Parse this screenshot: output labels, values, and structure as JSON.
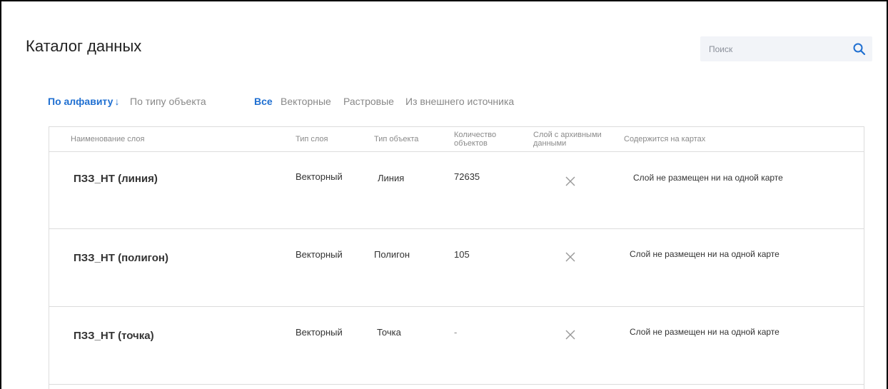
{
  "page": {
    "title": "Каталог данных"
  },
  "search": {
    "placeholder": "Поиск"
  },
  "sort": [
    {
      "label": "По алфавиту",
      "active": true,
      "arrow": "↓"
    },
    {
      "label": "По типу объекта",
      "active": false
    }
  ],
  "filters": [
    {
      "label": "Все",
      "active": true
    },
    {
      "label": "Векторные",
      "active": false
    },
    {
      "label": "Растровые",
      "active": false
    },
    {
      "label": "Из внешнего источника",
      "active": false
    }
  ],
  "table": {
    "headers": {
      "name": "Наименование слоя",
      "layer_type": "Тип слоя",
      "object_type": "Тип объекта",
      "count": "Количество объектов",
      "archive": "Слой с архивными данными",
      "maps": "Содержится на картах"
    },
    "rows": [
      {
        "name": "ПЗЗ_НТ (линия)",
        "layer_type": "Векторный",
        "object_type": "Линия",
        "count": "72635",
        "archive_icon": "close-icon",
        "maps": "Слой не размещен ни на одной карте"
      },
      {
        "name": "ПЗЗ_НТ (полигон)",
        "layer_type": "Векторный",
        "object_type": "Полигон",
        "count": "105",
        "archive_icon": "close-icon",
        "maps": "Слой не размещен ни на одной карте"
      },
      {
        "name": "ПЗЗ_НТ (точка)",
        "layer_type": "Векторный",
        "object_type": "Точка",
        "count": "-",
        "archive_icon": "close-icon",
        "maps": "Слой не размещен ни на одной карте"
      }
    ]
  },
  "colors": {
    "accent": "#1f6fd1",
    "muted": "#888888",
    "border": "#dcdcdc",
    "search_bg": "#f2f4f8"
  }
}
